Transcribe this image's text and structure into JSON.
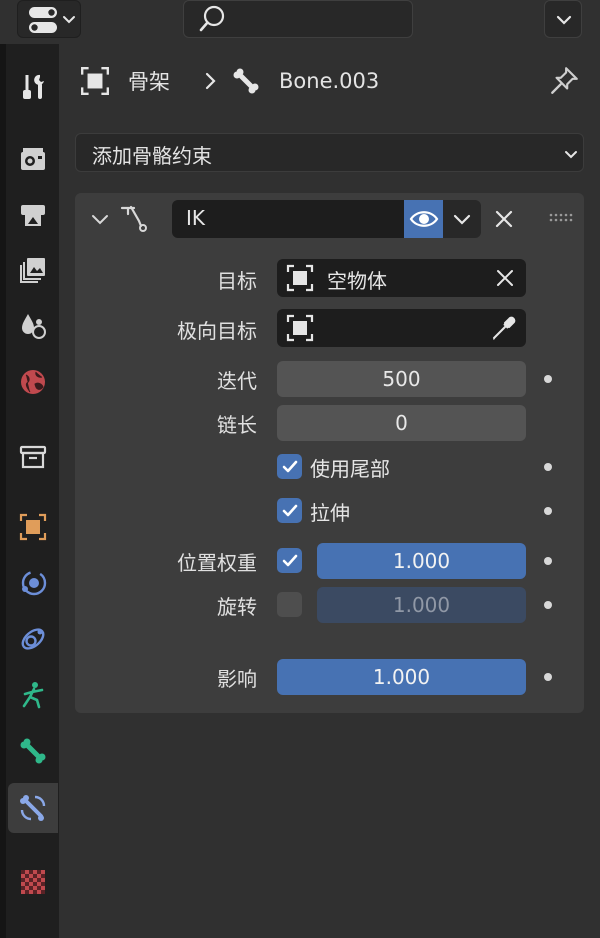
{
  "header": {
    "editor_type_icon": "properties-editor-icon",
    "search_icon": "search-icon",
    "options_icon": "chevron-down-icon"
  },
  "sidebar": {
    "tabs": [
      {
        "icon": "tool-icon"
      },
      {
        "icon": "render-icon"
      },
      {
        "icon": "output-icon"
      },
      {
        "icon": "view-layer-icon"
      },
      {
        "icon": "scene-icon"
      },
      {
        "icon": "world-icon"
      },
      {
        "icon": "collection-icon"
      },
      {
        "icon": "object-icon"
      },
      {
        "icon": "modifiers-icon"
      },
      {
        "icon": "physics-icon"
      },
      {
        "icon": "object-data-armature-icon"
      },
      {
        "icon": "bone-icon"
      },
      {
        "icon": "bone-constraint-icon",
        "active": true
      },
      {
        "icon": "texture-icon"
      }
    ]
  },
  "breadcrumb": {
    "armature": "骨架",
    "bone": "Bone.003"
  },
  "add_constraint": {
    "label": "添加骨骼约束"
  },
  "constraint": {
    "name": "IK",
    "target": {
      "label": "目标",
      "value": "空物体"
    },
    "pole_target": {
      "label": "极向目标",
      "value": ""
    },
    "iterations": {
      "label": "迭代",
      "value": "500"
    },
    "chain_length": {
      "label": "链长",
      "value": "0"
    },
    "use_tail": {
      "label": "使用尾部",
      "checked": true
    },
    "stretch": {
      "label": "拉伸",
      "checked": true
    },
    "weight_position": {
      "label": "位置权重",
      "checked": true,
      "value": "1.000"
    },
    "rotation": {
      "label": "旋转",
      "checked": false,
      "value": "1.000"
    },
    "influence": {
      "label": "影响",
      "value": "1.000"
    }
  },
  "colors": {
    "accent": "#4772b3",
    "panel": "#3d3d3d",
    "background": "#303030"
  }
}
